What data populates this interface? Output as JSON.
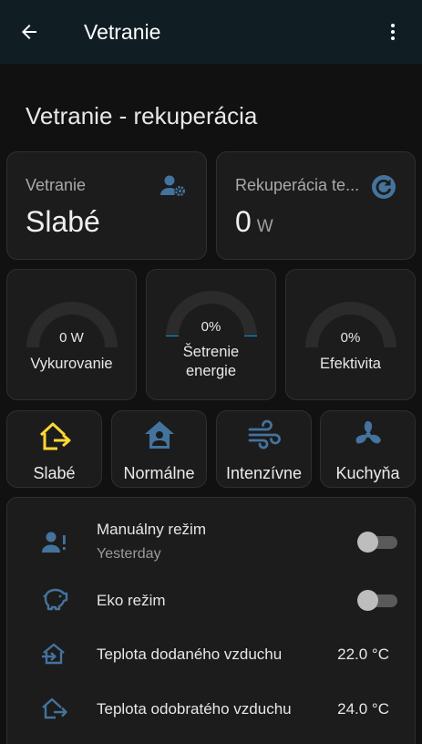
{
  "header": {
    "title": "Vetranie"
  },
  "section": {
    "title": "Vetranie - rekuperácia"
  },
  "tiles": {
    "ventilation": {
      "label": "Vetranie",
      "value": "Slabé",
      "icon": "account-cog-icon"
    },
    "recovery": {
      "label": "Rekuperácia te...",
      "value": "0",
      "unit": "W",
      "icon": "refresh-circle-icon"
    }
  },
  "gauges": [
    {
      "value": "0 W",
      "name": "Vykurovanie",
      "level": 0
    },
    {
      "value": "0%",
      "name": "Šetrenie energie",
      "level": 0
    },
    {
      "value": "0%",
      "name": "Efektivita",
      "level": 0
    }
  ],
  "modes": [
    {
      "label": "Slabé",
      "icon": "home-export-icon",
      "color": "#fdd835",
      "active": true
    },
    {
      "label": "Normálne",
      "icon": "home-account-icon",
      "color": "#44739e",
      "active": false
    },
    {
      "label": "Intenzívne",
      "icon": "weather-windy-icon",
      "color": "#44739e",
      "active": false
    },
    {
      "label": "Kuchyňa",
      "icon": "fan-icon",
      "color": "#44739e",
      "active": false
    }
  ],
  "entities": {
    "manual": {
      "name": "Manuálny režim",
      "sub": "Yesterday",
      "state": false
    },
    "eco": {
      "name": "Eko režim",
      "state": false
    },
    "supply": {
      "name": "Teplota dodaného vzduchu",
      "value": "22.0 °C"
    },
    "exhaust": {
      "name": "Teplota odobratého vzduchu",
      "value": "24.0 °C"
    }
  },
  "colors": {
    "icon": "#44739e",
    "active": "#fdd835",
    "gauge_track": "#2b2b2b",
    "gauge_fill": "#039be5"
  }
}
